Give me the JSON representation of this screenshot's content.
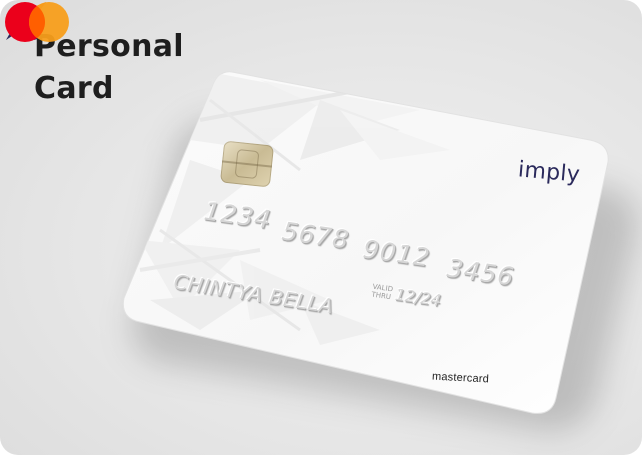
{
  "title": {
    "line1": "Personal",
    "line2": "Card"
  },
  "card": {
    "number_groups": [
      "1234",
      "5678",
      "9012",
      "3456"
    ],
    "holder_name": "CHINTYA BELLA",
    "valid_label_1": "VALID",
    "valid_label_2": "THRU",
    "expiry": "12/24",
    "brand_logo_text": "imply",
    "network_label": "mastercard",
    "chip_icon": "sim-chip-icon",
    "colors": {
      "mastercard_red": "#eb001b",
      "mastercard_orange": "#f79e1b",
      "brand_navy": "#2b2a5c",
      "brand_orange": "#f07a1e"
    }
  }
}
